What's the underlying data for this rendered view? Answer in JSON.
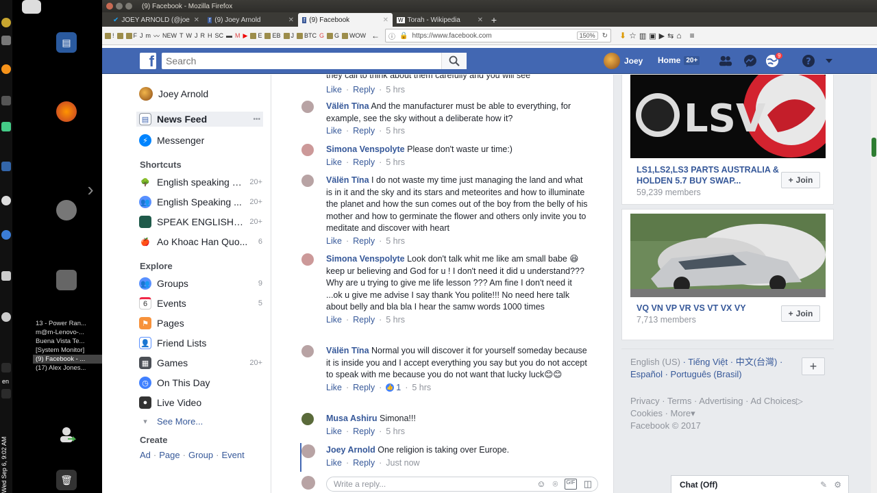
{
  "os": {
    "clock": "Wed Sep 6, 9:02 AM",
    "lang": "en",
    "taskbar": [
      {
        "label": "13 - Power Ran..."
      },
      {
        "label": "m@m-Lenovo-..."
      },
      {
        "label": "Buena Vista Te..."
      },
      {
        "label": "[System Monitor]"
      },
      {
        "label": "(9) Facebook - ..."
      },
      {
        "label": "(17) Alex Jones..."
      }
    ]
  },
  "browser": {
    "window_title": "(9) Facebook - Mozilla Firefox",
    "tabs": [
      {
        "label": "JOEY ARNOLD (@joe"
      },
      {
        "label": "(9) Joey Arnold"
      },
      {
        "label": "(9) Facebook"
      },
      {
        "label": "Torah - Wikipedia"
      }
    ],
    "bookmarks": [
      "!",
      "F",
      "J",
      "m",
      "NEW",
      "T",
      "W",
      "J",
      "R",
      "H",
      "SC",
      "M",
      "E",
      "EB",
      "J",
      "BTC",
      "G",
      "G",
      "WOW"
    ],
    "url": "https://www.facebook.com",
    "zoom": "150%"
  },
  "header": {
    "search_placeholder": "Search",
    "user_name": "Joey",
    "home_label": "Home",
    "home_badge": "20+",
    "notif_count": "9"
  },
  "leftnav": {
    "profile_name": "Joey Arnold",
    "news_feed": "News Feed",
    "more_dots": "•••",
    "messenger": "Messenger",
    "shortcuts_title": "Shortcuts",
    "shortcuts": [
      {
        "label": "English speaking g...",
        "count": "20+"
      },
      {
        "label": "English Speaking ...",
        "count": "20+"
      },
      {
        "label": "SPEAK ENGLISH ...",
        "count": "20+"
      },
      {
        "label": "Ao Khoac Han Quo...",
        "count": "6"
      }
    ],
    "explore_title": "Explore",
    "explore": [
      {
        "label": "Groups",
        "count": "9"
      },
      {
        "label": "Events",
        "count": "5"
      },
      {
        "label": "Pages",
        "count": ""
      },
      {
        "label": "Friend Lists",
        "count": ""
      },
      {
        "label": "Games",
        "count": "20+"
      },
      {
        "label": "On This Day",
        "count": ""
      },
      {
        "label": "Live Video",
        "count": ""
      }
    ],
    "events_icon_num": "6",
    "see_more": "See More...",
    "create_title": "Create",
    "create_links": [
      "Ad",
      "Page",
      "Group",
      "Event"
    ]
  },
  "feed": {
    "truncated_text": "they call to think about them carefully and you will see",
    "like_label": "Like",
    "reply_label": "Reply",
    "comments": [
      {
        "name": "Välën Tïna",
        "text": "And the manufacturer must be able to everything, for example, see the sky without a deliberate how it?",
        "time": "5 hrs"
      },
      {
        "name": "Simona Venspolyte",
        "text": "Please don't waste ur time:)",
        "time": "5 hrs"
      },
      {
        "name": "Välën Tïna",
        "text": "I do not waste my time just managing the land and what is in it and the sky and its stars and meteorites and how to illuminate the planet and how the sun comes out of the boy from the belly of his mother and how to germinate the flower and others only invite you to meditate and discover with heart",
        "time": "5 hrs"
      },
      {
        "name": "Simona Venspolyte",
        "text": "Look don't talk whit me like am small babe 😆 keep ur believing and God for u ! I don't need it did u understand??? Why are u trying to give me life lesson ??? Am fine I don't need it ...ok u give me advise I say thank You polite!!! No need here talk about belly and bla bla I hear the samw words 1000 times",
        "time": "5 hrs"
      },
      {
        "name": "Välën Tïna",
        "text": "Normal you will discover it for yourself someday because it is inside you and I accept everything you say but you do not accept to speak with me because you do not want that lucky luck😊😊",
        "time": "5 hrs",
        "likes": "1"
      },
      {
        "name": "Musa Ashiru",
        "text": "Simona!!!",
        "time": "5 hrs"
      },
      {
        "name": "Joey Arnold",
        "text": "One religion is taking over Europe.",
        "time": "Just now"
      }
    ],
    "reply_placeholder": "Write a reply..."
  },
  "rightcol": {
    "groups": [
      {
        "name": "LS1,LS2,LS3 PARTS AUSTRALIA & HOLDEN 5.7 BUY SWAP...",
        "members": "59,239 members",
        "join": "Join",
        "img_text": "LSV"
      },
      {
        "name": "VQ VN VP VR VS VT VX VY",
        "members": "7,713 members",
        "join": "Join"
      }
    ],
    "languages": {
      "current": "English (US)",
      "others": [
        "Tiếng Việt",
        "中文(台灣)",
        "Español",
        "Português (Brasil)"
      ]
    },
    "footer": {
      "links": [
        "Privacy",
        "Terms",
        "Advertising",
        "Ad Choices",
        "Cookies",
        "More"
      ],
      "copyright": "Facebook © 2017"
    }
  },
  "chat": {
    "label": "Chat (Off)"
  }
}
